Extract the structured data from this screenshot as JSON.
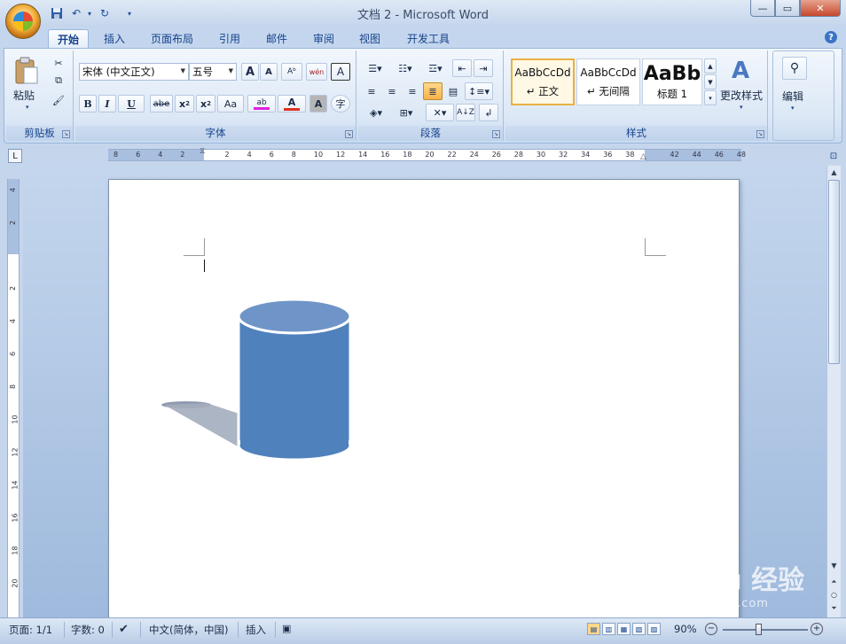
{
  "window": {
    "title": "文档 2 - Microsoft Word",
    "min_icon": "minimize-icon",
    "max_icon": "maximize-icon",
    "close_icon": "close-icon"
  },
  "quick_access": {
    "save_icon": "save-icon",
    "undo_icon": "undo-icon",
    "redo_icon": "redo-icon",
    "customize_icon": "chevron-down-icon"
  },
  "tabs": [
    {
      "label": "开始",
      "active": true
    },
    {
      "label": "插入"
    },
    {
      "label": "页面布局"
    },
    {
      "label": "引用"
    },
    {
      "label": "邮件"
    },
    {
      "label": "审阅"
    },
    {
      "label": "视图"
    },
    {
      "label": "开发工具"
    }
  ],
  "ribbon": {
    "clipboard": {
      "label": "剪贴板",
      "paste_label": "粘贴"
    },
    "font": {
      "label": "字体",
      "font_name": "宋体 (中文正文)",
      "font_size": "五号",
      "grow_label": "A",
      "shrink_label": "A",
      "bold": "B",
      "italic": "I",
      "underline": "U",
      "strike": "abe",
      "subscript": "x",
      "superscript": "x",
      "case": "Aa",
      "highlight": "ab",
      "font_color": "A",
      "char_shading": "A",
      "wen": "wén\n变",
      "border_a": "A",
      "enclose": "字"
    },
    "paragraph": {
      "label": "段落"
    },
    "styles": {
      "label": "样式",
      "items": [
        {
          "preview": "AaBbCcDd",
          "name": "↵ 正文",
          "selected": true
        },
        {
          "preview": "AaBbCcDd",
          "name": "↵ 无间隔"
        },
        {
          "preview": "AaBb",
          "name": "标题 1"
        }
      ],
      "change_label": "更改样式"
    },
    "editing": {
      "label": "编辑"
    }
  },
  "ruler": {
    "h_ticks": [
      "8",
      "6",
      "4",
      "2",
      "2",
      "4",
      "6",
      "8",
      "10",
      "12",
      "14",
      "16",
      "18",
      "20",
      "22",
      "24",
      "26",
      "28",
      "30",
      "32",
      "34",
      "36",
      "38",
      "42",
      "44",
      "46",
      "48"
    ],
    "v_ticks": [
      "4",
      "2",
      "2",
      "4",
      "6",
      "8",
      "10",
      "12",
      "14",
      "16",
      "18",
      "20"
    ]
  },
  "status": {
    "page": "页面: 1/1",
    "words": "字数: 0",
    "language": "中文(简体，中国)",
    "mode": "插入",
    "zoom": "90%"
  },
  "watermark": {
    "text": "Bai du 经验",
    "sub": "jingyan.baidu.com"
  },
  "colors": {
    "cylinder": "#4f81bd",
    "cylinder_top": "#6f95c8",
    "shadow": "#9ca8b8"
  }
}
